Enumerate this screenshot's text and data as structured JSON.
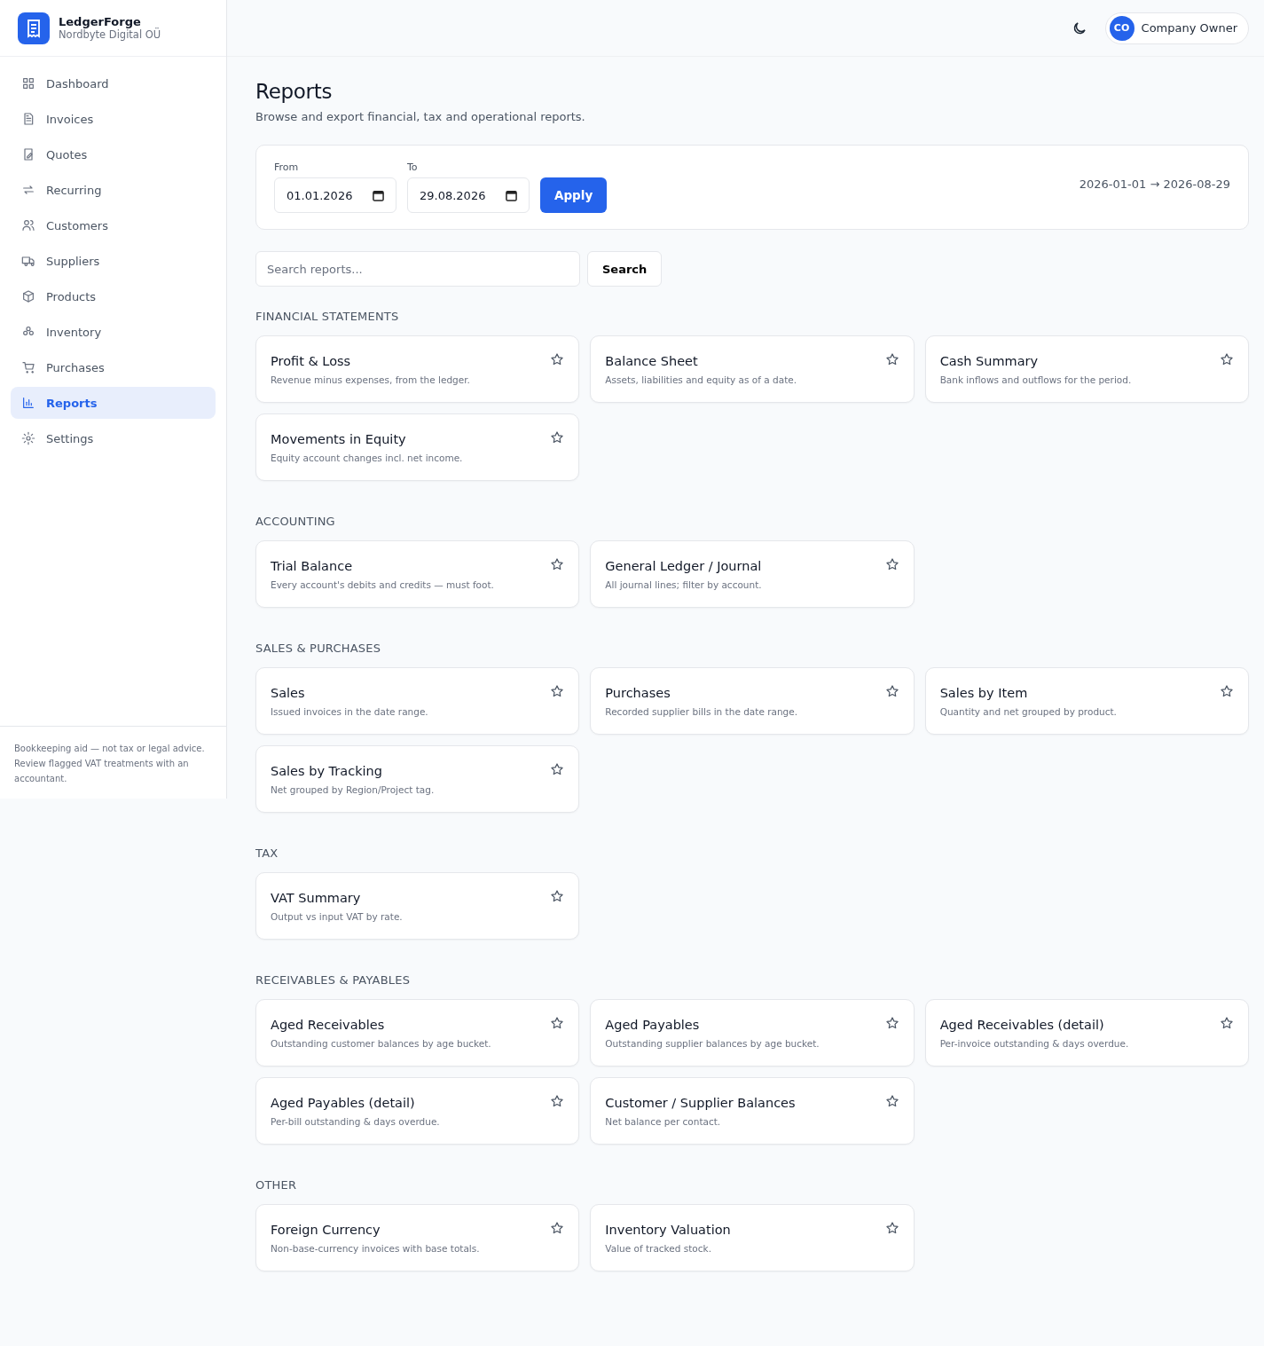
{
  "brand": {
    "name": "LedgerForge",
    "company": "Nordbyte Digital OÜ"
  },
  "nav": [
    {
      "label": "Dashboard",
      "selected": false
    },
    {
      "label": "Invoices",
      "selected": false
    },
    {
      "label": "Quotes",
      "selected": false
    },
    {
      "label": "Recurring",
      "selected": false
    },
    {
      "label": "Customers",
      "selected": false
    },
    {
      "label": "Suppliers",
      "selected": false
    },
    {
      "label": "Products",
      "selected": false
    },
    {
      "label": "Inventory",
      "selected": false
    },
    {
      "label": "Purchases",
      "selected": false
    },
    {
      "label": "Reports",
      "selected": true
    },
    {
      "label": "Settings",
      "selected": false
    }
  ],
  "sidebar_footer": "Bookkeeping aid — not tax or legal advice. Review flagged VAT treatments with an accountant.",
  "user": {
    "initials": "CO",
    "name": "Company Owner"
  },
  "page": {
    "title": "Reports",
    "subtitle": "Browse and export financial, tax and operational reports."
  },
  "filter": {
    "from_label": "From",
    "from_value": "01.01.2026",
    "to_label": "To",
    "to_value": "29.08.2026",
    "apply": "Apply",
    "range": "2026-01-01 → 2026-08-29"
  },
  "search": {
    "placeholder": "Search reports...",
    "button": "Search"
  },
  "sections": [
    {
      "title": "FINANCIAL STATEMENTS",
      "reports": [
        {
          "title": "Profit & Loss",
          "description": "Revenue minus expenses, from the ledger.",
          "favorite": false
        },
        {
          "title": "Balance Sheet",
          "description": "Assets, liabilities and equity as of a date.",
          "favorite": false
        },
        {
          "title": "Cash Summary",
          "description": "Bank inflows and outflows for the period.",
          "favorite": false
        },
        {
          "title": "Movements in Equity",
          "description": "Equity account changes incl. net income.",
          "favorite": false
        }
      ]
    },
    {
      "title": "ACCOUNTING",
      "reports": [
        {
          "title": "Trial Balance",
          "description": "Every account's debits and credits — must foot.",
          "favorite": false
        },
        {
          "title": "General Ledger / Journal",
          "description": "All journal lines; filter by account.",
          "favorite": false
        }
      ]
    },
    {
      "title": "SALES & PURCHASES",
      "reports": [
        {
          "title": "Sales",
          "description": "Issued invoices in the date range.",
          "favorite": false
        },
        {
          "title": "Purchases",
          "description": "Recorded supplier bills in the date range.",
          "favorite": false
        },
        {
          "title": "Sales by Item",
          "description": "Quantity and net grouped by product.",
          "favorite": false
        },
        {
          "title": "Sales by Tracking",
          "description": "Net grouped by Region/Project tag.",
          "favorite": false
        }
      ]
    },
    {
      "title": "TAX",
      "reports": [
        {
          "title": "VAT Summary",
          "description": "Output vs input VAT by rate.",
          "favorite": false
        }
      ]
    },
    {
      "title": "RECEIVABLES & PAYABLES",
      "reports": [
        {
          "title": "Aged Receivables",
          "description": "Outstanding customer balances by age bucket.",
          "favorite": false
        },
        {
          "title": "Aged Payables",
          "description": "Outstanding supplier balances by age bucket.",
          "favorite": false
        },
        {
          "title": "Aged Receivables (detail)",
          "description": "Per-invoice outstanding & days overdue.",
          "favorite": false
        },
        {
          "title": "Aged Payables (detail)",
          "description": "Per-bill outstanding & days overdue.",
          "favorite": false
        },
        {
          "title": "Customer / Supplier Balances",
          "description": "Net balance per contact.",
          "favorite": false
        }
      ]
    },
    {
      "title": "OTHER",
      "reports": [
        {
          "title": "Foreign Currency",
          "description": "Non-base-currency invoices with base totals.",
          "favorite": false
        },
        {
          "title": "Inventory Valuation",
          "description": "Value of tracked stock.",
          "favorite": false
        }
      ]
    }
  ]
}
